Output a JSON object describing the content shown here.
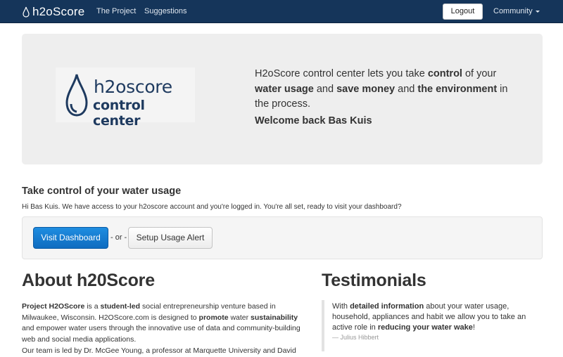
{
  "navbar": {
    "brand": "h2oScore",
    "links": [
      "The Project",
      "Suggestions"
    ],
    "logout_label": "Logout",
    "community_label": "Community",
    "background": "#15355a"
  },
  "hero": {
    "logo_line1": "h2oscore",
    "logo_line2": "control center",
    "text_parts": [
      "H2oScore control center lets you take ",
      "control",
      " of your ",
      "water usage",
      " and ",
      "save money",
      " and ",
      "the environment",
      " in the process."
    ],
    "welcome": "Welcome back Bas Kuis"
  },
  "take_control": {
    "title": "Take control of your water usage",
    "subtitle": "Hi Bas Kuis. We have access to your h2oscore account and you're logged in. You're all set, ready to visit your dashboard?",
    "primary_button": "Visit Dashboard",
    "or_label": "- or -",
    "secondary_button": "Setup Usage Alert",
    "accent": "#1a7fd4"
  },
  "about": {
    "title": "About h20Score",
    "p1_parts": [
      "Project H2OScore",
      " is a ",
      "student-led",
      " social entrepreneurship venture based in Milwaukee, Wisconsin. H2OScore.com is designed to ",
      "promote",
      " water ",
      "sustainability",
      " and empower water users through the innovative use of data and community-building web and social media applications."
    ],
    "p2": "Our team is led by Dr. McGee Young, a professor at Marquette University and David"
  },
  "testimonials": {
    "title": "Testimonials",
    "quote_parts": [
      "With ",
      "detailed information",
      " about your water usage, household, appliances and habit we allow you to take an active role in ",
      "reducing your water wake",
      "!"
    ],
    "author": "— Julius Hibbert"
  }
}
